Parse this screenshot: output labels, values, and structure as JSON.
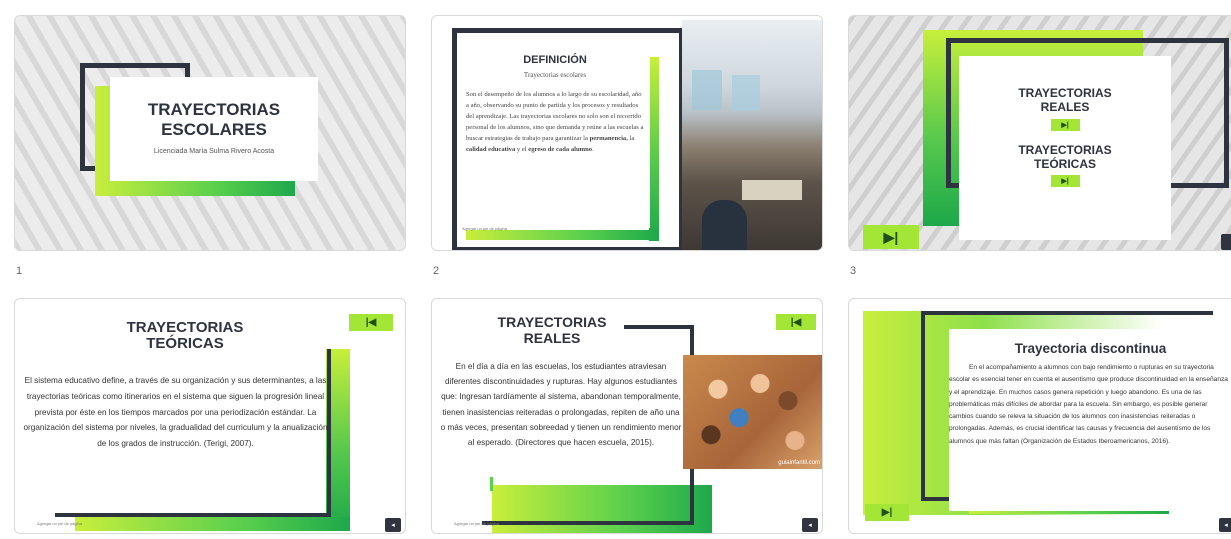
{
  "slides": [
    {
      "number": "1",
      "title_line1": "TRAYECTORIAS",
      "title_line2": "ESCOLARES",
      "subtitle": "Licenciada María Sulma Rivero Acosta"
    },
    {
      "number": "2",
      "title": "DEFINICIÓN",
      "subtitle": "Trayectorias escolares",
      "body": "Son el desempeño de los alumnos a lo largo de su escolaridad, año a año, observando su punto de partida y los procesos y resultados del aprendizaje. Las trayectorias escolares no solo son el recorrido personal de los alumnos, sino que demanda y reúne a las escuelas a buscar estrategias de trabajo para garantizar la ",
      "bold1": "permanencia,",
      "mid1": " la ",
      "bold2": "calidad educativa",
      "mid2": " y el ",
      "bold3": "egreso de cada alumno",
      "end": ".",
      "footer": "Agregar un pie de página"
    },
    {
      "number": "3",
      "link1_line1": "TRAYECTORIAS",
      "link1_line2": "REALES",
      "link2_line1": "TRAYECTORIAS",
      "link2_line2": "TEÓRICAS",
      "play_symbol": "▶|"
    },
    {
      "title_line1": "TRAYECTORIAS",
      "title_line2": "TEÓRICAS",
      "body": "El sistema educativo define, a través de su organización y sus determinantes, a las trayectorias teóricas como itinerarios en el sistema que siguen la progresión lineal prevista por éste en los tiempos marcados por una periodización estándar. La organización del sistema por niveles, la gradualidad del curriculum y la anualización de los grados de instrucción. (Terigi, 2007).",
      "back_symbol": "|◀",
      "footer": "Agregar un pie de página",
      "corner": "◂"
    },
    {
      "title_line1": "TRAYECTORIAS",
      "title_line2": "REALES",
      "body": "En el día a día en las escuelas, los estudiantes atraviesan diferentes discontinuidades y rupturas. Hay algunos estudiantes que: Ingresan tardíamente al sistema, abandonan temporalmente, tienen inasistencias reiteradas o prolongadas, repiten de año una o más veces, presentan sobreedad y tienen un rendimiento menor al esperado. (Directores que hacen escuela, 2015).",
      "watermark": "guiainfantil.com",
      "back_symbol": "|◀",
      "footer": "Agregar un pie de página",
      "corner": "◂"
    },
    {
      "title": "Trayectoria discontinua",
      "body": "En el acompañamiento a alumnos con bajo rendimiento o rupturas en su trayectoria escolar es esencial tener en cuenta el ausentismo que produce discontinuidad en la enseñanza y el aprendizaje. En muchos casos genera repetición y luego abandono. Es una de las problemáticas más difíciles de abordar para la escuela. Sin embargo, es posible generar cambios cuando se releva la situación de los alumnos con inasistencias reiteradas o prolongadas. Además, es crucial identificar las causas y frecuencia del ausentismo de los alumnos que más faltan (Organización de Estados Iberoamericanos, 2016).",
      "play_symbol": "▶|",
      "corner": "◂"
    }
  ]
}
